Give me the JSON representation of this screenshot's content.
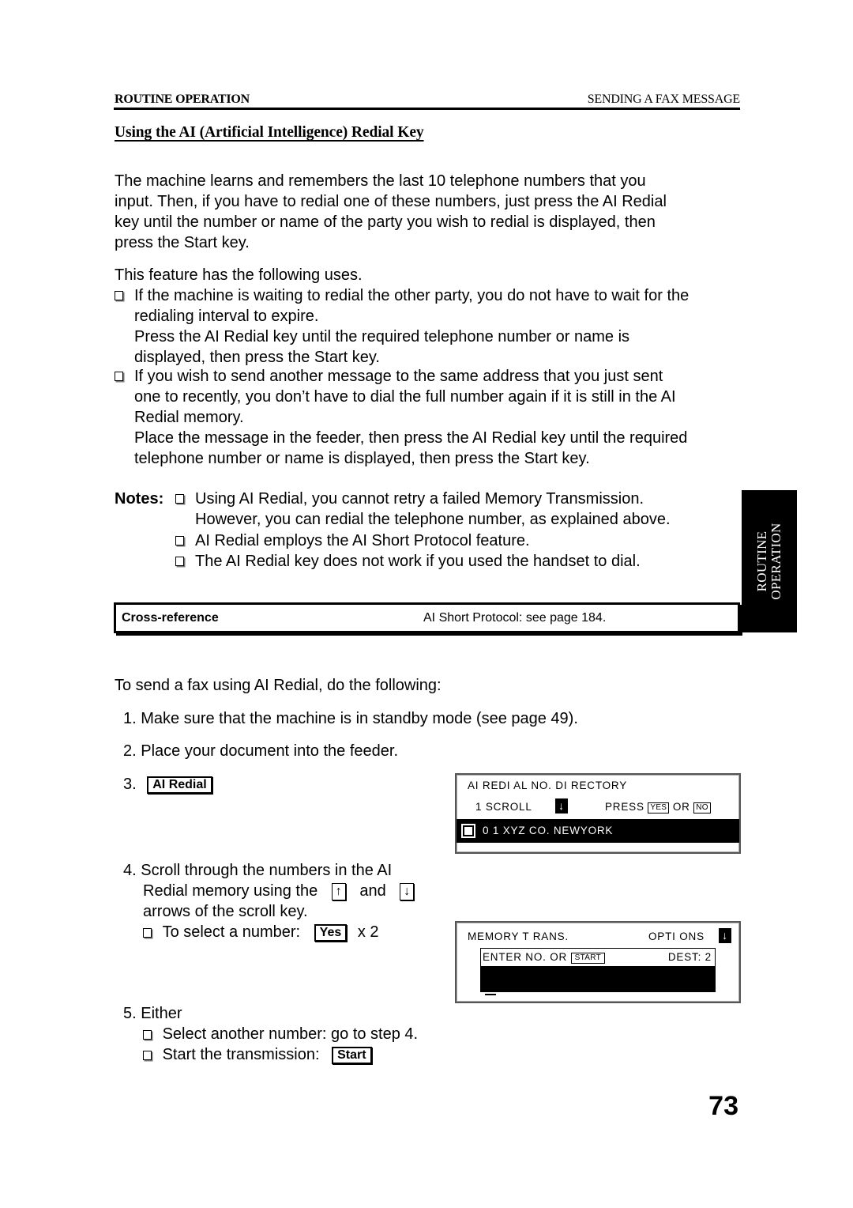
{
  "header": {
    "section": "ROUTINE OPERATION",
    "chapter": "SENDING A FAX MESSAGE"
  },
  "title": "Using the AI (Artificial Intelligence) Redial Key",
  "intro": [
    "The machine learns and remembers the last 10 telephone numbers that you",
    "input. Then, if you have to redial one of these numbers, just press the AI Redial",
    "key until the number or name of the party you wish to redial is displayed, then",
    "press the Start key."
  ],
  "uses_intro": "This feature has the following uses.",
  "uses": [
    {
      "lines": [
        "If the machine is waiting to redial the other party, you do not have to wait for the",
        "redialing interval to expire.",
        "Press the AI Redial key until the required telephone number or name is",
        "displayed, then press the Start key."
      ]
    },
    {
      "lines": [
        "If you wish to send another message to the same address that you just sent",
        "one to recently, you don’t have to dial the full number again if it is still in the AI",
        "Redial memory.",
        "Place the message in the feeder, then press the AI Redial key until the required",
        "telephone number or name is displayed, then press the Start key."
      ]
    }
  ],
  "notes": {
    "label": "Notes:",
    "items": [
      {
        "lines": [
          "Using AI Redial, you cannot retry a failed Memory Transmission.",
          "However, you can redial the telephone number, as explained above."
        ]
      },
      {
        "lines": [
          "AI Redial employs the AI Short Protocol feature."
        ]
      },
      {
        "lines": [
          "The AI Redial key does not work if you used the handset to dial."
        ]
      }
    ]
  },
  "cross_reference": {
    "label": "Cross-reference",
    "value": "AI Short Protocol: see page 184."
  },
  "side_tab": {
    "line1": "ROUTINE",
    "line2": "OPERATION"
  },
  "procedure": {
    "intro": "To send a fax using AI Redial, do the following:",
    "step1": "1. Make sure that the machine is in standby mode (see page 49).",
    "step2": "2. Place your document into the feeder.",
    "step3_num": "3.",
    "step3_key": "AI Redial",
    "step4": {
      "line1": "4. Scroll through the numbers in the AI",
      "line2_a": "Redial memory using the",
      "up_arrow": "↑",
      "line2_b": "and",
      "down_arrow": "↓",
      "line3": "arrows of the scroll key.",
      "select_label": "To select a number:",
      "select_key": "Yes",
      "select_times": "x 2"
    },
    "step5": {
      "line1": "5. Either",
      "option1": "Select another number: go to step 4.",
      "option2_label": "Start the transmission:",
      "option2_key": "Start"
    }
  },
  "lcd_redial": {
    "line1": "AI  REDI AL NO.  DI RECTORY",
    "line2_left": "1  SCROLL",
    "scroll_arrow": "↓",
    "line2_press": "PRESS",
    "yes_key": "YES",
    "or": "OR",
    "no_key": "NO",
    "selected_entry": "0 1   XYZ  CO.   NEWYORK"
  },
  "lcd_memory": {
    "line1_left": "MEMORY  T RANS.",
    "line1_right": "OPTI  ONS",
    "options_arrow": "↓",
    "enter_label": "ENTER NO.  OR",
    "start_key": "START",
    "dest_label": "DEST:  2"
  },
  "page_number": "73"
}
